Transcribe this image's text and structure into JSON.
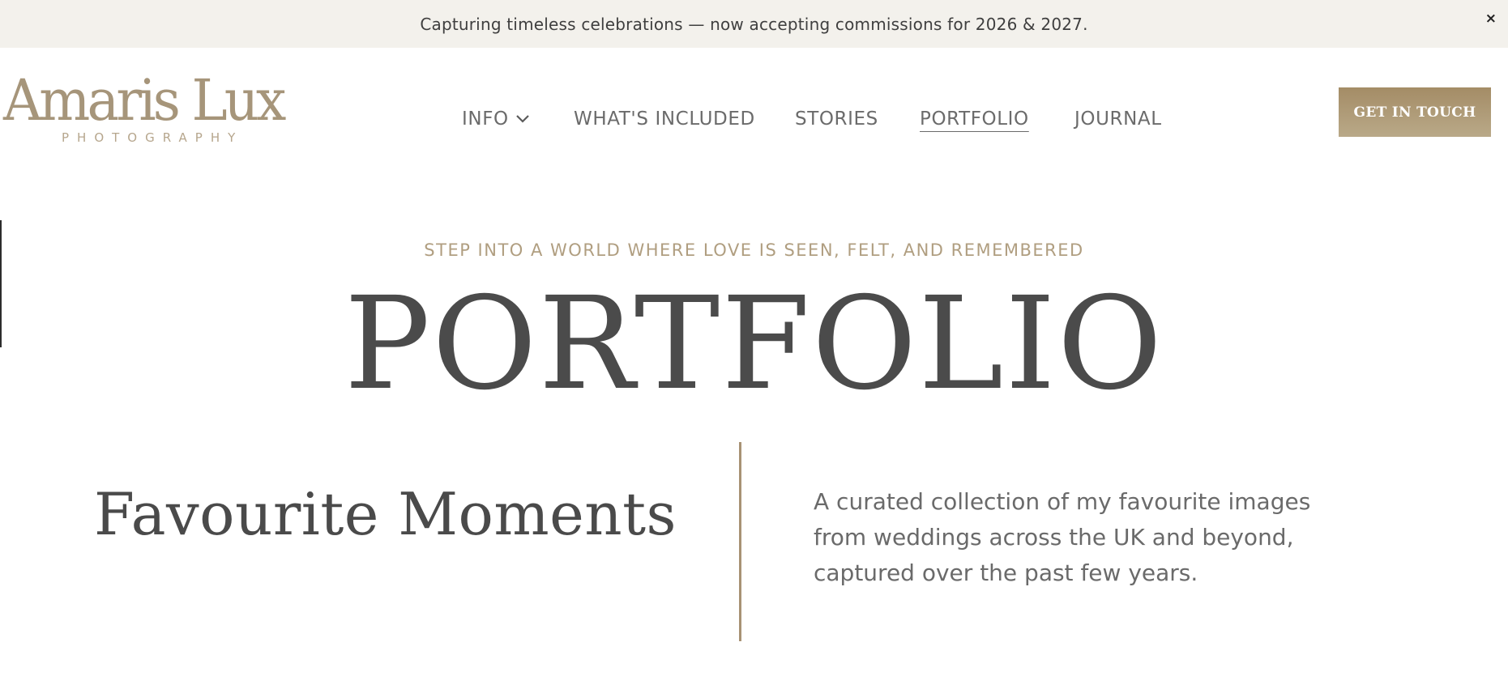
{
  "announcement": {
    "text": "Capturing timeless celebrations — now accepting commissions for 2026 & 2027.",
    "close_label": "×"
  },
  "logo": {
    "main": "Amaris Lux",
    "sub": "PHOTOGRAPHY"
  },
  "nav": {
    "items": [
      {
        "label": "INFO",
        "has_dropdown": true
      },
      {
        "label": "WHAT'S INCLUDED"
      },
      {
        "label": "STORIES"
      },
      {
        "label": "PORTFOLIO",
        "active": true
      },
      {
        "label": "JOURNAL"
      }
    ],
    "cta_label": "GET IN TOUCH"
  },
  "hero": {
    "eyebrow": "STEP INTO A WORLD WHERE LOVE IS SEEN, FELT, AND REMEMBERED",
    "title": "PORTFOLIO"
  },
  "intro": {
    "title": "Favourite Moments",
    "description": "A curated collection of my favourite images from weddings across the UK and beyond, captured over the past few years."
  },
  "colors": {
    "accent": "#a89274",
    "announcement_bg": "#f3f1ec",
    "text": "#4a4a4a"
  }
}
